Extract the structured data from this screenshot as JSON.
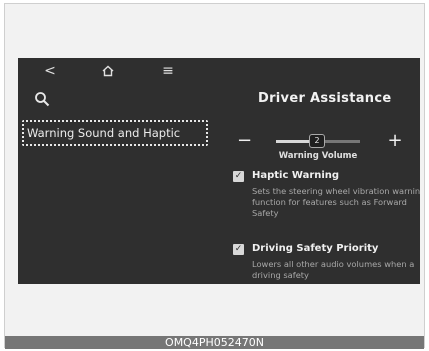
{
  "nav": {
    "back_glyph": "<",
    "menu_glyph": "≡"
  },
  "left": {
    "selected_item": "Warning Sound and Haptic"
  },
  "panel": {
    "title": "Driver Assistance",
    "volume": {
      "minus": "−",
      "plus": "+",
      "value": "2",
      "level_fraction": 0.4,
      "label": "Warning Volume"
    },
    "options": [
      {
        "checked": true,
        "title": "Haptic Warning",
        "description": "Sets the steering wheel vibration warning function for features such as Forward Safety"
      },
      {
        "checked": true,
        "title": "Driving Safety Priority",
        "description": "Lowers all other audio volumes when a driving safety"
      }
    ]
  },
  "caption": "OMQ4PH052470N",
  "colors": {
    "screen_bg": "#2f2f2f",
    "caption_bg": "#767676"
  },
  "icons": [
    "back-icon",
    "home-icon",
    "menu-icon",
    "search-icon",
    "checkbox-icon"
  ]
}
